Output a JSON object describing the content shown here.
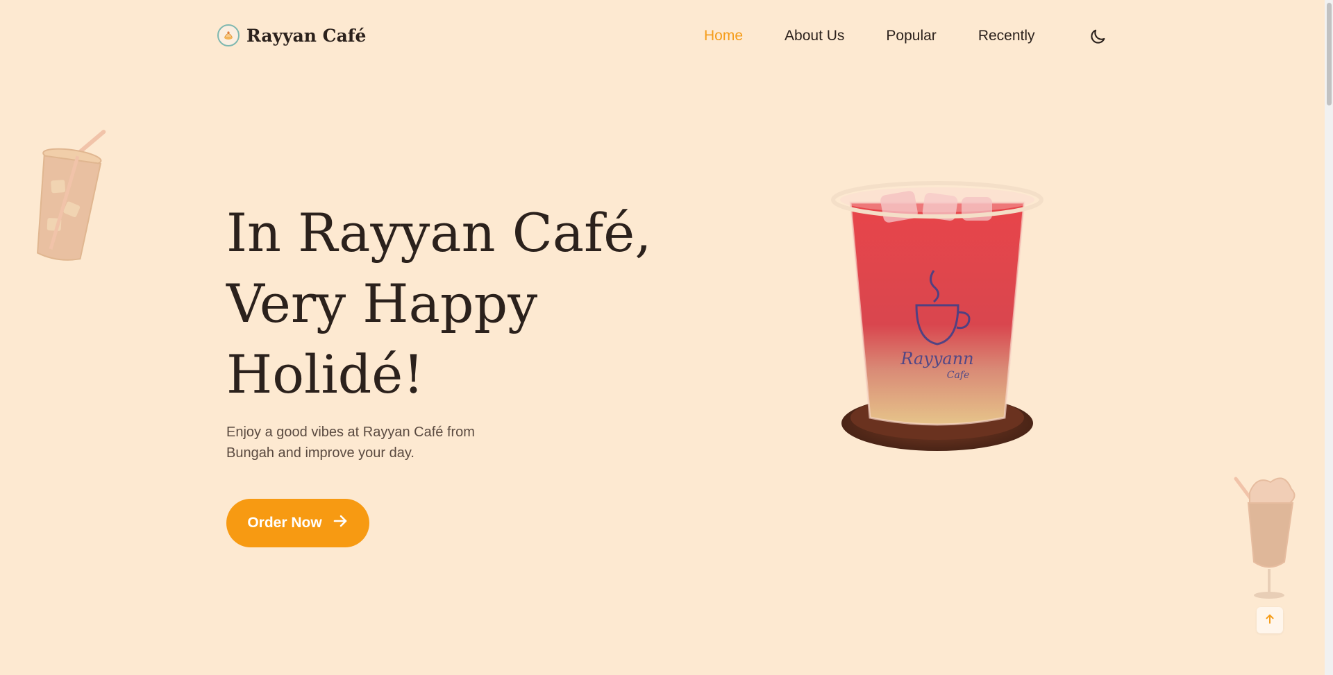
{
  "header": {
    "brand_name": "Rayyan Café",
    "nav": [
      {
        "label": "Home",
        "active": true
      },
      {
        "label": "About Us",
        "active": false
      },
      {
        "label": "Popular",
        "active": false
      },
      {
        "label": "Recently",
        "active": false
      }
    ],
    "theme_toggle_icon": "moon-icon"
  },
  "hero": {
    "title_lines": [
      "In Rayyan Café,",
      "Very Happy",
      "Holidé!"
    ],
    "description": "Enjoy a good vibes at Rayyan Café from Bungah and improve your day.",
    "button_label": "Order Now",
    "button_icon": "arrow-right-icon"
  },
  "scroll_up_icon": "arrow-up-icon",
  "colors": {
    "background": "#fde9d1",
    "accent": "#f79a12",
    "text": "#2b211c"
  }
}
